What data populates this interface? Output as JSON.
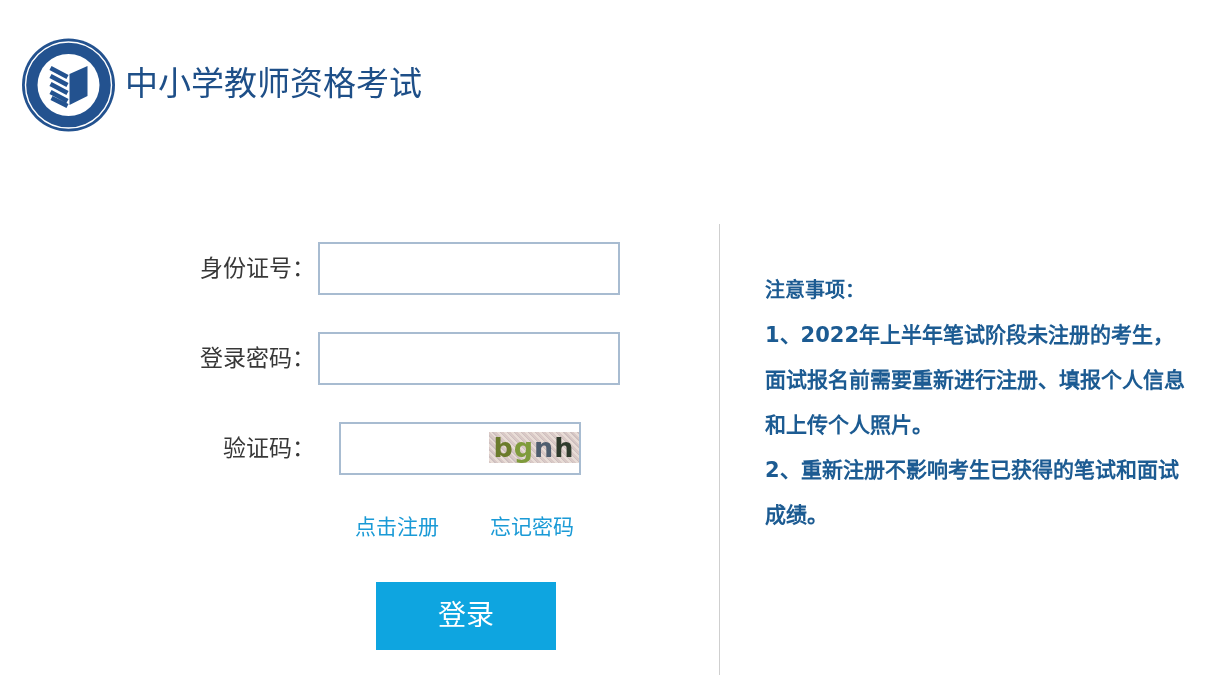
{
  "header": {
    "title": "中小学教师资格考试"
  },
  "login_form": {
    "fields": [
      {
        "label": "身份证号："
      },
      {
        "label": "登录密码："
      },
      {
        "label": "验证码：",
        "captcha_text": "bgnh"
      }
    ],
    "links": [
      "点击注册",
      "忘记密码"
    ],
    "submit_button": "登录"
  },
  "notice": {
    "heading": "注意事项：",
    "items": [
      "1、2022年上半年笔试阶段未注册的考生，面试报名前需要重新进行注册、填报个人信息和上传个人照片。",
      "2、重新注册不影响考生已获得的笔试和面试成绩。"
    ]
  }
}
